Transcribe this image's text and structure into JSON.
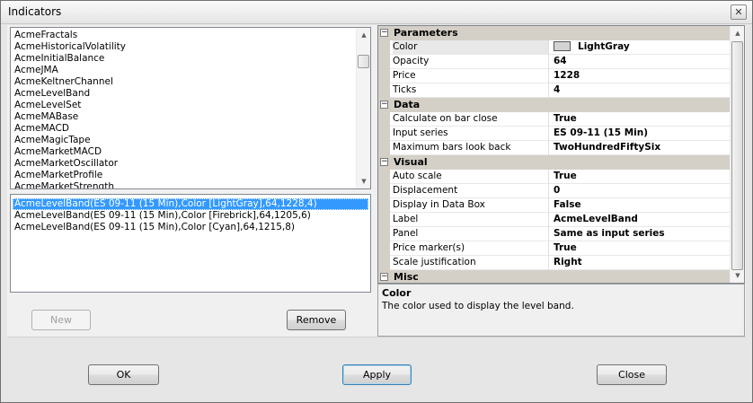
{
  "window": {
    "title": "Indicators",
    "close_glyph": "✕"
  },
  "indicator_list": {
    "items": [
      "AcmeFractals",
      "AcmeHistoricalVolatility",
      "AcmeInitialBalance",
      "AcmeJMA",
      "AcmeKeltnerChannel",
      "AcmeLevelBand",
      "AcmeLevelSet",
      "AcmeMABase",
      "AcmeMACD",
      "AcmeMagicTape",
      "AcmeMarketMACD",
      "AcmeMarketOscillator",
      "AcmeMarketProfile",
      "AcmeMarketStrength"
    ]
  },
  "applied_list": {
    "items": [
      {
        "label": "AcmeLevelBand(ES 09-11 (15 Min),Color [LightGray],64,1228,4)",
        "selected": true
      },
      {
        "label": "AcmeLevelBand(ES 09-11 (15 Min),Color [Firebrick],64,1205,6)",
        "selected": false
      },
      {
        "label": "AcmeLevelBand(ES 09-11 (15 Min),Color [Cyan],64,1215,8)",
        "selected": false
      }
    ]
  },
  "buttons": {
    "new": "New",
    "remove": "Remove",
    "ok": "OK",
    "apply": "Apply",
    "close": "Close"
  },
  "property_grid": {
    "categories": [
      {
        "name": "Parameters",
        "toggle": "⊟",
        "properties": [
          {
            "name": "Color",
            "value": "LightGray",
            "swatch": "#d3d3d3",
            "selected": true
          },
          {
            "name": "Opacity",
            "value": "64"
          },
          {
            "name": "Price",
            "value": "1228"
          },
          {
            "name": "Ticks",
            "value": "4"
          }
        ]
      },
      {
        "name": "Data",
        "toggle": "⊟",
        "properties": [
          {
            "name": "Calculate on bar close",
            "value": "True"
          },
          {
            "name": "Input series",
            "value": "ES 09-11 (15 Min)"
          },
          {
            "name": "Maximum bars look back",
            "value": "TwoHundredFiftySix"
          }
        ]
      },
      {
        "name": "Visual",
        "toggle": "⊟",
        "properties": [
          {
            "name": "Auto scale",
            "value": "True"
          },
          {
            "name": "Displacement",
            "value": "0"
          },
          {
            "name": "Display in Data Box",
            "value": "False"
          },
          {
            "name": "Label",
            "value": "AcmeLevelBand"
          },
          {
            "name": "Panel",
            "value": "Same as input series"
          },
          {
            "name": "Price marker(s)",
            "value": "True"
          },
          {
            "name": "Scale justification",
            "value": "Right"
          }
        ]
      },
      {
        "name": "Misc",
        "toggle": "⊟",
        "properties": []
      }
    ]
  },
  "description": {
    "title": "Color",
    "text": "The color used to display the level band."
  }
}
